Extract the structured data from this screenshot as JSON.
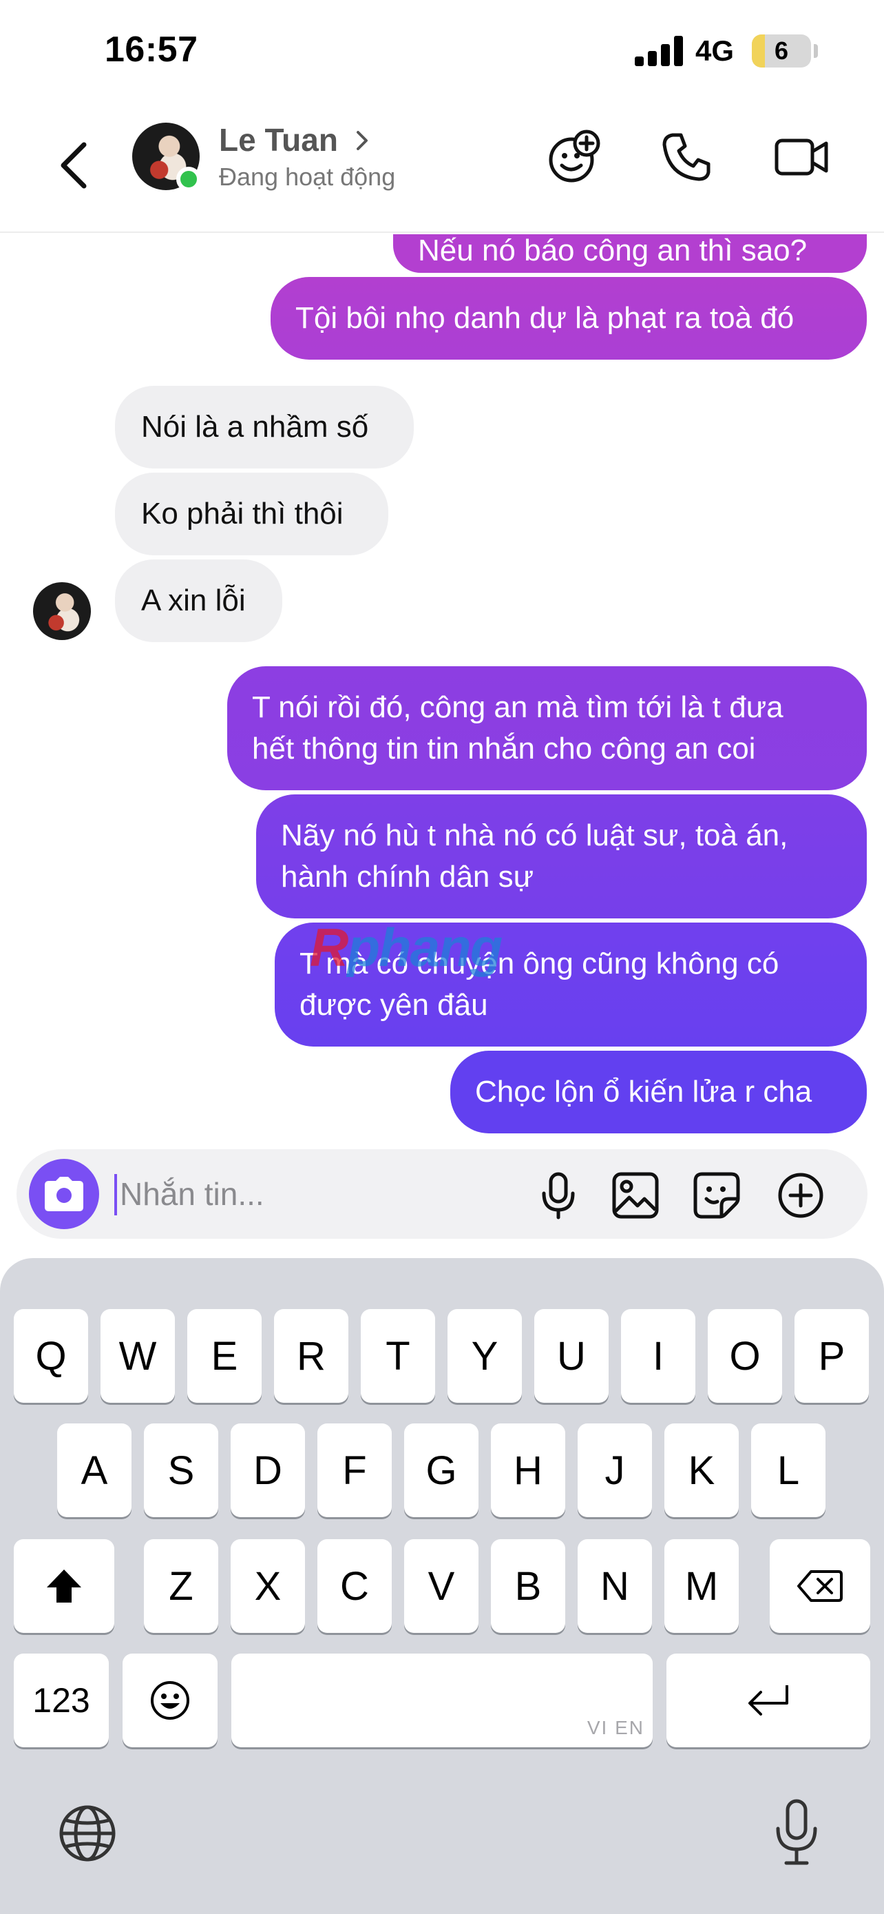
{
  "status_bar": {
    "time": "16:57",
    "network": "4G",
    "battery": "6",
    "battery_level": 0.06
  },
  "header": {
    "contact_name": "Le Tuan",
    "contact_status": "Đang hoạt động",
    "icons": [
      "back-chevron-icon",
      "avatar",
      "add-emoji-group-icon",
      "phone-icon",
      "video-camera-icon"
    ]
  },
  "messages": [
    {
      "side": "out",
      "text": "Nếu nó báo công an thì sao?"
    },
    {
      "side": "out",
      "text": "Tội bôi nhọ danh dự là phạt ra toà đó"
    },
    {
      "side": "in",
      "text": "Nói là a nhầm số"
    },
    {
      "side": "in",
      "text": "Ko phải thì thôi"
    },
    {
      "side": "in",
      "text": "A xin lỗi"
    },
    {
      "side": "out",
      "line1": "T nói rồi đó, công an mà tìm tới là t đưa",
      "line2": "hết thông tin tin nhắn cho công an coi"
    },
    {
      "side": "out",
      "line1": "Nãy nó hù t nhà nó có luật sư, toà án,",
      "line2": "hành chính dân sự"
    },
    {
      "side": "out",
      "line1": "T mà có chuyện ông cũng không có",
      "line2": "được yên đâu"
    },
    {
      "side": "out",
      "text": "Chọc lộn ổ kiến lửa r cha"
    }
  ],
  "watermark": {
    "first": "R",
    "rest": "phang"
  },
  "composer": {
    "placeholder": "Nhắn tin...",
    "icons": [
      "camera-icon",
      "microphone-icon",
      "image-icon",
      "sticker-icon",
      "plus-circle-icon"
    ]
  },
  "keyboard": {
    "row1": [
      "Q",
      "W",
      "E",
      "R",
      "T",
      "Y",
      "U",
      "I",
      "O",
      "P"
    ],
    "row2": [
      "A",
      "S",
      "D",
      "F",
      "G",
      "H",
      "J",
      "K",
      "L"
    ],
    "row3": [
      "Z",
      "X",
      "C",
      "V",
      "B",
      "N",
      "M"
    ],
    "numbers_key": "123",
    "spacebar_hint": "VI EN",
    "icons": [
      "shift-icon",
      "backspace-icon",
      "emoji-icon",
      "return-icon",
      "globe-icon",
      "dictation-icon"
    ]
  },
  "colors": {
    "accent": "#7a4ff3",
    "bubble_top": "#b23fd0",
    "bubble_bottom": "#5f3df0",
    "incoming": "#efeff1",
    "online": "#31c24d"
  }
}
